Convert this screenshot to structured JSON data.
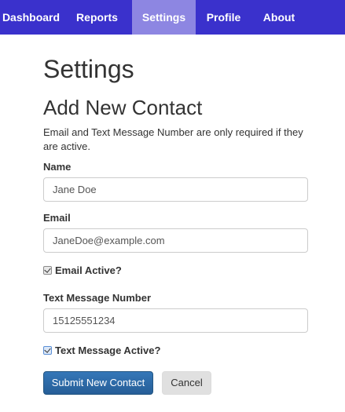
{
  "nav": {
    "items": [
      {
        "label": "Dashboard"
      },
      {
        "label": "Reports"
      },
      {
        "label": "Settings"
      },
      {
        "label": "Profile"
      },
      {
        "label": "About"
      }
    ],
    "active": "Settings"
  },
  "page": {
    "title": "Settings",
    "section_title": "Add New Contact",
    "help_text": "Email and Text Message Number are only required if they are active."
  },
  "form": {
    "name": {
      "label": "Name",
      "value": "Jane Doe"
    },
    "email": {
      "label": "Email",
      "value": "JaneDoe@example.com"
    },
    "email_active": {
      "label": "Email Active?",
      "checked": true
    },
    "text_number": {
      "label": "Text Message Number",
      "value": "15125551234"
    },
    "text_active": {
      "label": "Text Message Active?",
      "checked": true
    }
  },
  "actions": {
    "submit_label": "Submit New Contact",
    "cancel_label": "Cancel"
  },
  "colors": {
    "navbar": "#3a31cc",
    "nav_active": "#8d86e2",
    "primary_button": "#2e6da4"
  }
}
